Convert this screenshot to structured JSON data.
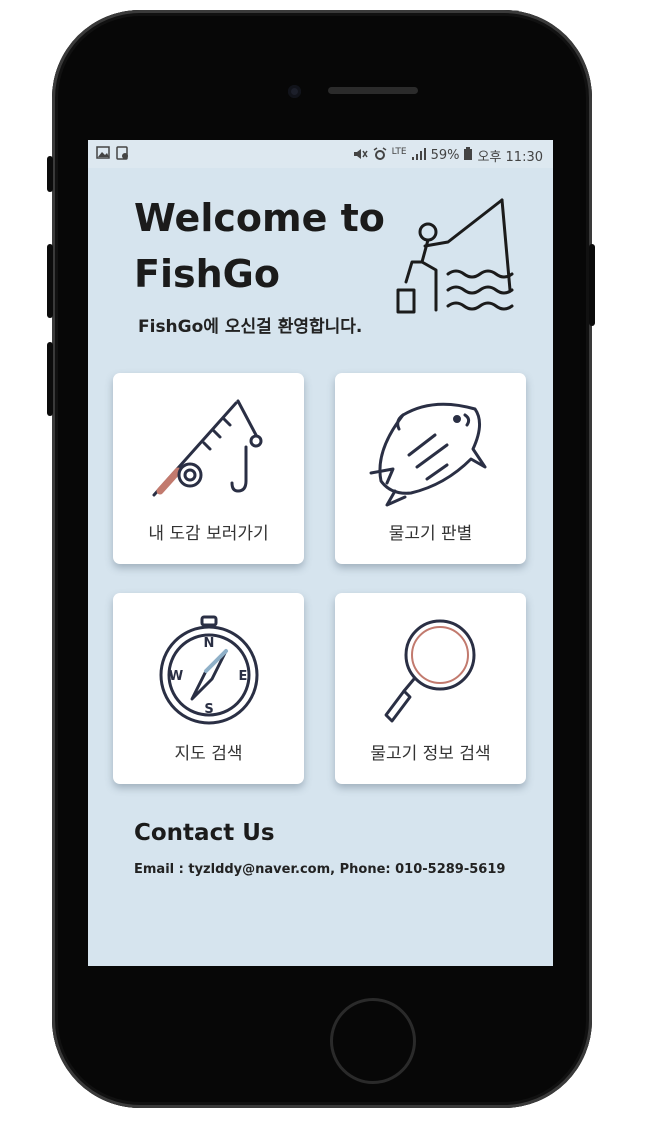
{
  "status_bar": {
    "battery": "59%",
    "network": "LTE",
    "time": "오후 11:30"
  },
  "hero": {
    "title_line1": "Welcome to",
    "title_line2": "FishGo",
    "subtitle": "FishGo에 오신걸 환영합니다.",
    "illustration_icon": "fisherman-icon"
  },
  "menu": [
    {
      "label": "내 도감 보러가기",
      "icon": "fishing-rod-icon"
    },
    {
      "label": "물고기 판별",
      "icon": "fish-icon"
    },
    {
      "label": "지도 검색",
      "icon": "compass-icon"
    },
    {
      "label": "물고기 정보 검색",
      "icon": "magnifier-icon"
    }
  ],
  "contact": {
    "title": "Contact Us",
    "info": "Email : tyzlddy@naver.com, Phone: 010-5289-5619"
  },
  "colors": {
    "screen_bg": "#d6e4ee",
    "card_bg": "#ffffff",
    "phone_body": "#070707"
  }
}
